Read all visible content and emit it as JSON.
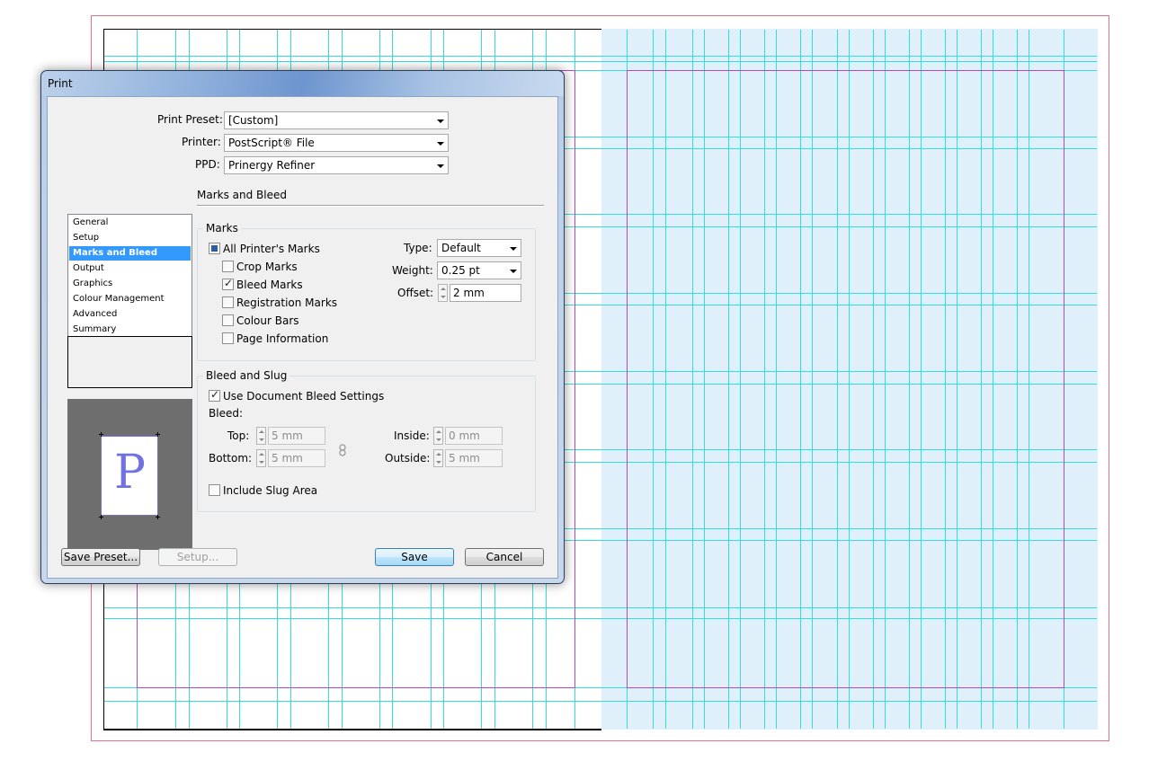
{
  "dialog": {
    "title": "Print",
    "print_preset": {
      "label": "Print Preset:",
      "value": "[Custom]"
    },
    "printer": {
      "label": "Printer:",
      "value": "PostScript® File"
    },
    "ppd": {
      "label": "PPD:",
      "value": "Prinergy Refiner"
    },
    "nav_items": [
      "General",
      "Setup",
      "Marks and Bleed",
      "Output",
      "Graphics",
      "Colour Management",
      "Advanced",
      "Summary"
    ],
    "selected_nav": "Marks and Bleed",
    "preview_letter": "P",
    "section_title": "Marks and Bleed",
    "marks": {
      "group_title": "Marks",
      "all_printers_marks": "All Printer's Marks",
      "crop_marks": "Crop Marks",
      "bleed_marks": "Bleed Marks",
      "registration_marks": "Registration Marks",
      "colour_bars": "Colour Bars",
      "page_information": "Page Information",
      "type_label": "Type:",
      "type_value": "Default",
      "weight_label": "Weight:",
      "weight_value": "0.25 pt",
      "offset_label": "Offset:",
      "offset_value": "2 mm"
    },
    "bleed_slug": {
      "group_title": "Bleed and Slug",
      "use_document_bleed": "Use Document Bleed Settings",
      "bleed_label": "Bleed:",
      "top_label": "Top:",
      "top_value": "5 mm",
      "bottom_label": "Bottom:",
      "bottom_value": "5 mm",
      "inside_label": "Inside:",
      "inside_value": "0 mm",
      "outside_label": "Outside:",
      "outside_value": "5 mm",
      "include_slug": "Include Slug Area"
    },
    "buttons": {
      "save_preset": "Save Preset...",
      "setup": "Setup...",
      "save": "Save",
      "cancel": "Cancel"
    }
  },
  "colors": {
    "guide": "#33dddd",
    "margin": "#b04ac0",
    "bleed": "#e8708c",
    "selection": "#3399ff"
  }
}
